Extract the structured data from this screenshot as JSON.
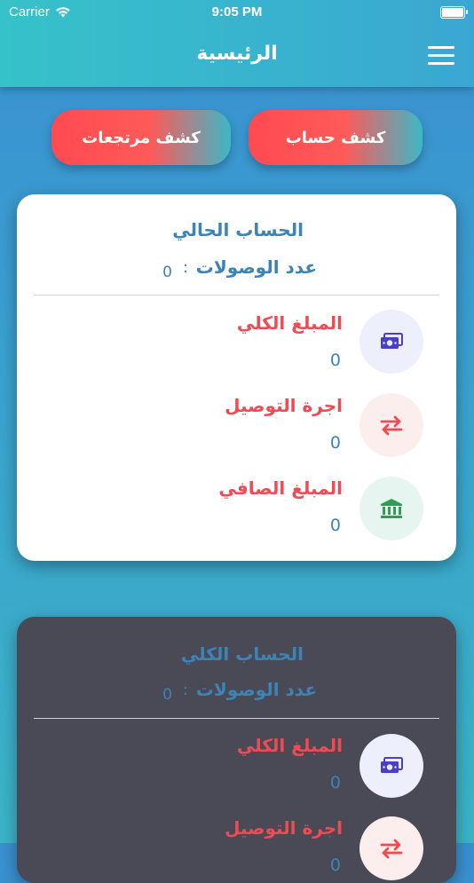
{
  "status_bar": {
    "carrier": "Carrier",
    "time": "9:05 PM"
  },
  "header": {
    "title": "الرئيسية",
    "menu_icon": "hamburger-menu-icon"
  },
  "actions": {
    "account_statement": "كشف حساب",
    "returns_statement": "كشف مرتجعات"
  },
  "current_account": {
    "title": "الحساب الحالي",
    "receipts_label": "عدد الوصولات",
    "colon": ":",
    "receipts_count": "0",
    "rows": [
      {
        "label": "المبلغ الكلي",
        "value": "0",
        "icon": "money-bill-icon"
      },
      {
        "label": "اجرة التوصيل",
        "value": "0",
        "icon": "exchange-arrows-icon"
      },
      {
        "label": "المبلغ الصافي",
        "value": "0",
        "icon": "bank-icon"
      }
    ]
  },
  "total_account": {
    "title": "الحساب الكلي",
    "receipts_label": "عدد الوصولات",
    "colon": ":",
    "receipts_count": "0",
    "rows": [
      {
        "label": "المبلغ الكلي",
        "value": "0",
        "icon": "money-bill-icon"
      },
      {
        "label": "اجرة التوصيل",
        "value": "0",
        "icon": "exchange-arrows-icon"
      }
    ]
  },
  "colors": {
    "accent_blue": "#3a84b8",
    "accent_red": "#f04a52",
    "header_gradient_start": "#36c2c9",
    "header_gradient_end": "#3aa7d2",
    "dark_card": "#4a4a57"
  }
}
